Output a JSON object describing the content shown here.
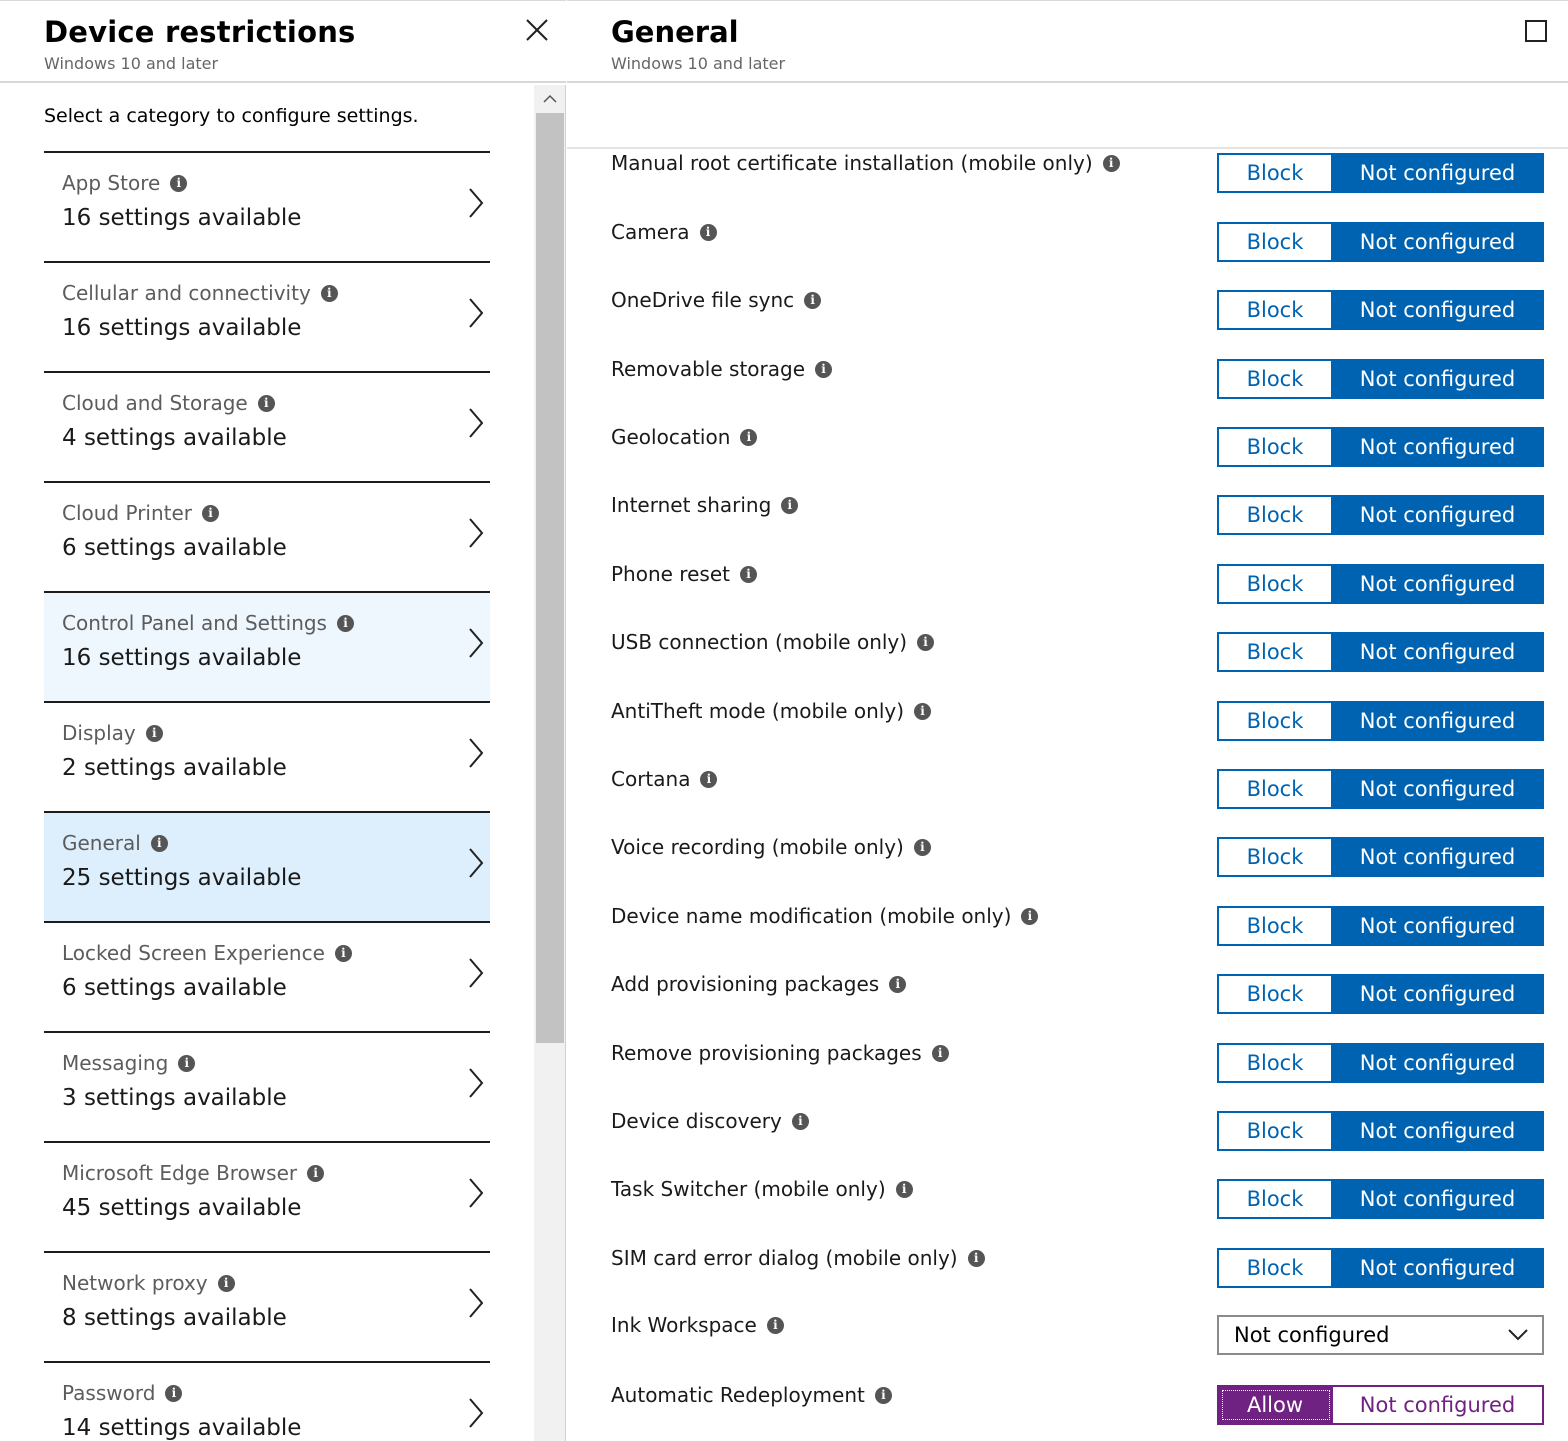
{
  "left_blade": {
    "title": "Device restrictions",
    "subtitle": "Windows 10 and later",
    "hint": "Select a category to configure settings.",
    "categories": [
      {
        "name": "App Store",
        "count": "16 settings available",
        "state": "normal"
      },
      {
        "name": "Cellular and connectivity",
        "count": "16 settings available",
        "state": "normal"
      },
      {
        "name": "Cloud and Storage",
        "count": "4 settings available",
        "state": "normal"
      },
      {
        "name": "Cloud Printer",
        "count": "6 settings available",
        "state": "normal"
      },
      {
        "name": "Control Panel and Settings",
        "count": "16 settings available",
        "state": "hover"
      },
      {
        "name": "Display",
        "count": "2 settings available",
        "state": "normal"
      },
      {
        "name": "General",
        "count": "25 settings available",
        "state": "selected"
      },
      {
        "name": "Locked Screen Experience",
        "count": "6 settings available",
        "state": "normal"
      },
      {
        "name": "Messaging",
        "count": "3 settings available",
        "state": "normal"
      },
      {
        "name": "Microsoft Edge Browser",
        "count": "45 settings available",
        "state": "normal"
      },
      {
        "name": "Network proxy",
        "count": "8 settings available",
        "state": "normal"
      },
      {
        "name": "Password",
        "count": "14 settings available",
        "state": "normal"
      }
    ]
  },
  "right_blade": {
    "title": "General",
    "subtitle": "Windows 10 and later",
    "settings": [
      {
        "label": "Manual root certificate installation (mobile only)",
        "control": "toggle",
        "option_a": "Block",
        "option_b": "Not configured",
        "selected": "Not configured"
      },
      {
        "label": "Camera",
        "control": "toggle",
        "option_a": "Block",
        "option_b": "Not configured",
        "selected": "Not configured"
      },
      {
        "label": "OneDrive file sync",
        "control": "toggle",
        "option_a": "Block",
        "option_b": "Not configured",
        "selected": "Not configured"
      },
      {
        "label": "Removable storage",
        "control": "toggle",
        "option_a": "Block",
        "option_b": "Not configured",
        "selected": "Not configured"
      },
      {
        "label": "Geolocation",
        "control": "toggle",
        "option_a": "Block",
        "option_b": "Not configured",
        "selected": "Not configured"
      },
      {
        "label": "Internet sharing",
        "control": "toggle",
        "option_a": "Block",
        "option_b": "Not configured",
        "selected": "Not configured"
      },
      {
        "label": "Phone reset",
        "control": "toggle",
        "option_a": "Block",
        "option_b": "Not configured",
        "selected": "Not configured"
      },
      {
        "label": "USB connection (mobile only)",
        "control": "toggle",
        "option_a": "Block",
        "option_b": "Not configured",
        "selected": "Not configured"
      },
      {
        "label": "AntiTheft mode (mobile only)",
        "control": "toggle",
        "option_a": "Block",
        "option_b": "Not configured",
        "selected": "Not configured"
      },
      {
        "label": "Cortana",
        "control": "toggle",
        "option_a": "Block",
        "option_b": "Not configured",
        "selected": "Not configured"
      },
      {
        "label": "Voice recording (mobile only)",
        "control": "toggle",
        "option_a": "Block",
        "option_b": "Not configured",
        "selected": "Not configured"
      },
      {
        "label": "Device name modification (mobile only)",
        "control": "toggle",
        "option_a": "Block",
        "option_b": "Not configured",
        "selected": "Not configured"
      },
      {
        "label": "Add provisioning packages",
        "control": "toggle",
        "option_a": "Block",
        "option_b": "Not configured",
        "selected": "Not configured"
      },
      {
        "label": "Remove provisioning packages",
        "control": "toggle",
        "option_a": "Block",
        "option_b": "Not configured",
        "selected": "Not configured"
      },
      {
        "label": "Device discovery",
        "control": "toggle",
        "option_a": "Block",
        "option_b": "Not configured",
        "selected": "Not configured"
      },
      {
        "label": "Task Switcher (mobile only)",
        "control": "toggle",
        "option_a": "Block",
        "option_b": "Not configured",
        "selected": "Not configured"
      },
      {
        "label": "SIM card error dialog (mobile only)",
        "control": "toggle",
        "option_a": "Block",
        "option_b": "Not configured",
        "selected": "Not configured"
      },
      {
        "label": "Ink Workspace",
        "control": "dropdown",
        "value": "Not configured"
      },
      {
        "label": "Automatic Redeployment",
        "control": "toggle",
        "option_a": "Allow",
        "option_b": "Not configured",
        "selected": "Allow",
        "accent": "purple"
      }
    ]
  },
  "colors": {
    "accent_blue": "#0063b1",
    "accent_purple": "#702283",
    "selected_row": "#ddeffc",
    "hover_row": "#eef6fe"
  },
  "icons": {
    "close": "close-icon",
    "maximize": "maximize-icon",
    "info": "info-icon",
    "chevron_right": "chevron-right-icon",
    "chevron_down": "chevron-down-icon",
    "scroll_up": "scroll-up-arrow-icon"
  }
}
